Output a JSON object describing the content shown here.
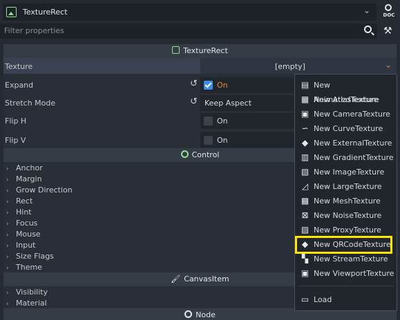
{
  "top": {
    "node_name": "TextureRect",
    "doc_label": "DOC"
  },
  "filter": {
    "placeholder": "Filter properties"
  },
  "sections": {
    "texture_rect": "TextureRect",
    "control": "Control",
    "canvas_item": "CanvasItem",
    "node": "Node"
  },
  "props": {
    "texture": {
      "label": "Texture",
      "value": "[empty]"
    },
    "expand": {
      "label": "Expand",
      "value": "On",
      "checked": true
    },
    "stretch_mode": {
      "label": "Stretch Mode",
      "value": "Keep Aspect"
    },
    "flip_h": {
      "label": "Flip H",
      "value": "On",
      "checked": false
    },
    "flip_v": {
      "label": "Flip V",
      "value": "On",
      "checked": false
    }
  },
  "control_items": [
    "Anchor",
    "Margin",
    "Grow Direction",
    "Rect",
    "Hint",
    "Focus",
    "Mouse",
    "Input",
    "Size Flags",
    "Theme"
  ],
  "canvas_items": [
    "Visibility",
    "Material"
  ],
  "menu": {
    "items": [
      {
        "label": "New AnimatedTexture",
        "icon": "film-icon"
      },
      {
        "label": "New AtlasTexture",
        "icon": "map-icon"
      },
      {
        "label": "New CameraTexture",
        "icon": "camera-icon"
      },
      {
        "label": "New CurveTexture",
        "icon": "curve-icon"
      },
      {
        "label": "New ExternalTexture",
        "icon": "cube-icon"
      },
      {
        "label": "New GradientTexture",
        "icon": "gradient-icon"
      },
      {
        "label": "New ImageTexture",
        "icon": "image-icon"
      },
      {
        "label": "New LargeTexture",
        "icon": "large-image-icon"
      },
      {
        "label": "New MeshTexture",
        "icon": "mesh-icon"
      },
      {
        "label": "New NoiseTexture",
        "icon": "noise-icon"
      },
      {
        "label": "New ProxyTexture",
        "icon": "proxy-icon"
      },
      {
        "label": "New QRCodeTexture",
        "icon": "cube-icon"
      },
      {
        "label": "New StreamTexture",
        "icon": "checker-icon"
      },
      {
        "label": "New ViewportTexture",
        "icon": "viewport-icon"
      }
    ],
    "load_label": "Load"
  },
  "colors": {
    "highlight": "#ffe600",
    "accent_blue": "#3d8fe6",
    "expand_on": "#e08a3c"
  }
}
